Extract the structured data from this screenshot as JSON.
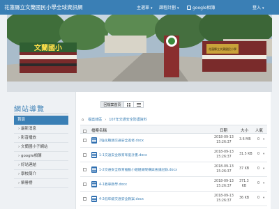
{
  "navbar": {
    "brand": "花蓮縣立文蘭國民小學全球資訊網",
    "menu_main": "主選單",
    "menu_curriculum": "課程計劃",
    "menu_google": "google相簿",
    "menu_login": "登入"
  },
  "banner": {
    "sign_text": "文蘭國小",
    "plaque_text": "花蓮縣立文蘭國民小學"
  },
  "sidebar": {
    "title": "網站導覽",
    "items": [
      {
        "label": "首頁"
      },
      {
        "label": "› 最新消息"
      },
      {
        "label": "› 影音播放"
      },
      {
        "label": "› 文蘭國小子網站"
      },
      {
        "label": "› google相簿"
      },
      {
        "label": "› 好站連結"
      },
      {
        "label": "› 學校簡介"
      },
      {
        "label": "› 榮譽榜"
      }
    ]
  },
  "toolbar": {
    "home_button": "回檔案首頁"
  },
  "breadcrumb": {
    "root": "檔案總區",
    "current": "107年交通安全防護資料"
  },
  "table": {
    "headers": {
      "name": "檔案名稱",
      "date": "日期",
      "size": "大小",
      "count": "人氣"
    },
    "rows": [
      {
        "name": "2強化戰頭交通安全進修.docx",
        "date1": "2018-09-13",
        "date2": "15:26:37",
        "size1": "3.6 MB",
        "size2": "",
        "count": "0"
      },
      {
        "name": "1-1交通安全教育年度計畫.docx",
        "date1": "2018-09-13",
        "date2": "15:26:37",
        "size1": "31.5 KB",
        "size2": "",
        "count": "0"
      },
      {
        "name": "1-2交通安全教育推動小組組織架構與會議記錄.docx",
        "date1": "2018-09-13",
        "date2": "15:26:37",
        "size1": "37 KB",
        "size2": "",
        "count": "0"
      },
      {
        "name": "4-1教車教學.docx",
        "date1": "2018-09-13",
        "date2": "15:26:37",
        "size1": "371.3",
        "size2": "KB",
        "count": "0"
      },
      {
        "name": "4-2低年級交通安全教案.docx",
        "date1": "2018-09-13",
        "date2": "15:26:37",
        "size1": "36 KB",
        "size2": "",
        "count": "0"
      }
    ]
  },
  "colors": {
    "navbar": "#3a7fb5",
    "accent": "#3a7fb5",
    "file_icon": "#2f6fb0"
  }
}
